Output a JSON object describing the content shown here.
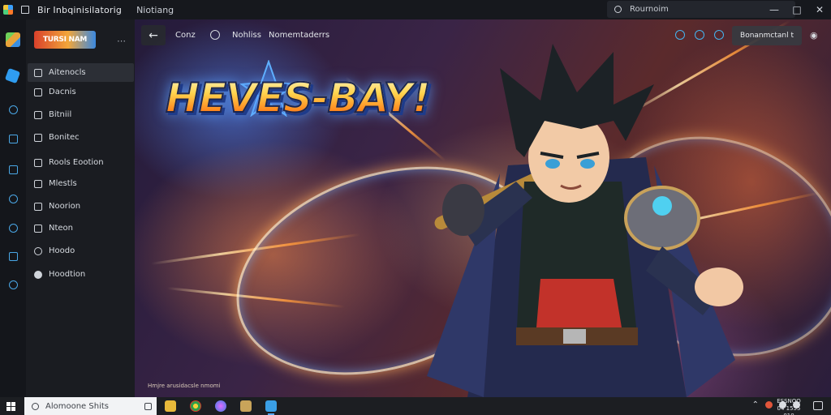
{
  "window": {
    "title": "Bir Inbqinisilatorig",
    "subtitle": "Niotiang",
    "search_text": "Rournoim"
  },
  "sidebar": {
    "brand_text": "TURSI NAM",
    "items": [
      {
        "label": "Aitenocls",
        "active": true
      },
      {
        "label": "Dacnis"
      },
      {
        "label": "Bitniil"
      },
      {
        "label": "Bonitec"
      },
      {
        "label": "Rools Eootion"
      },
      {
        "label": "Mlestls"
      },
      {
        "label": "Noorion"
      },
      {
        "label": "Nteon"
      },
      {
        "label": "Hoodo"
      },
      {
        "label": "Hoodtion"
      }
    ]
  },
  "hero": {
    "nav_links": [
      "Conz",
      "Nohliss",
      "Nomemtaderrs"
    ],
    "cta_label": "Bonanmctanl t",
    "logo_text": "HEVES-BAY!",
    "caption": "Hmjre arusidacsle nmomi"
  },
  "taskbar": {
    "search_text": "Alomoone Shits",
    "clock_time": "ESSNOO",
    "clock_date": "04 1555 010"
  },
  "colors": {
    "accent": "#2f9cf0",
    "rail_icon": "#4aa7e6"
  }
}
